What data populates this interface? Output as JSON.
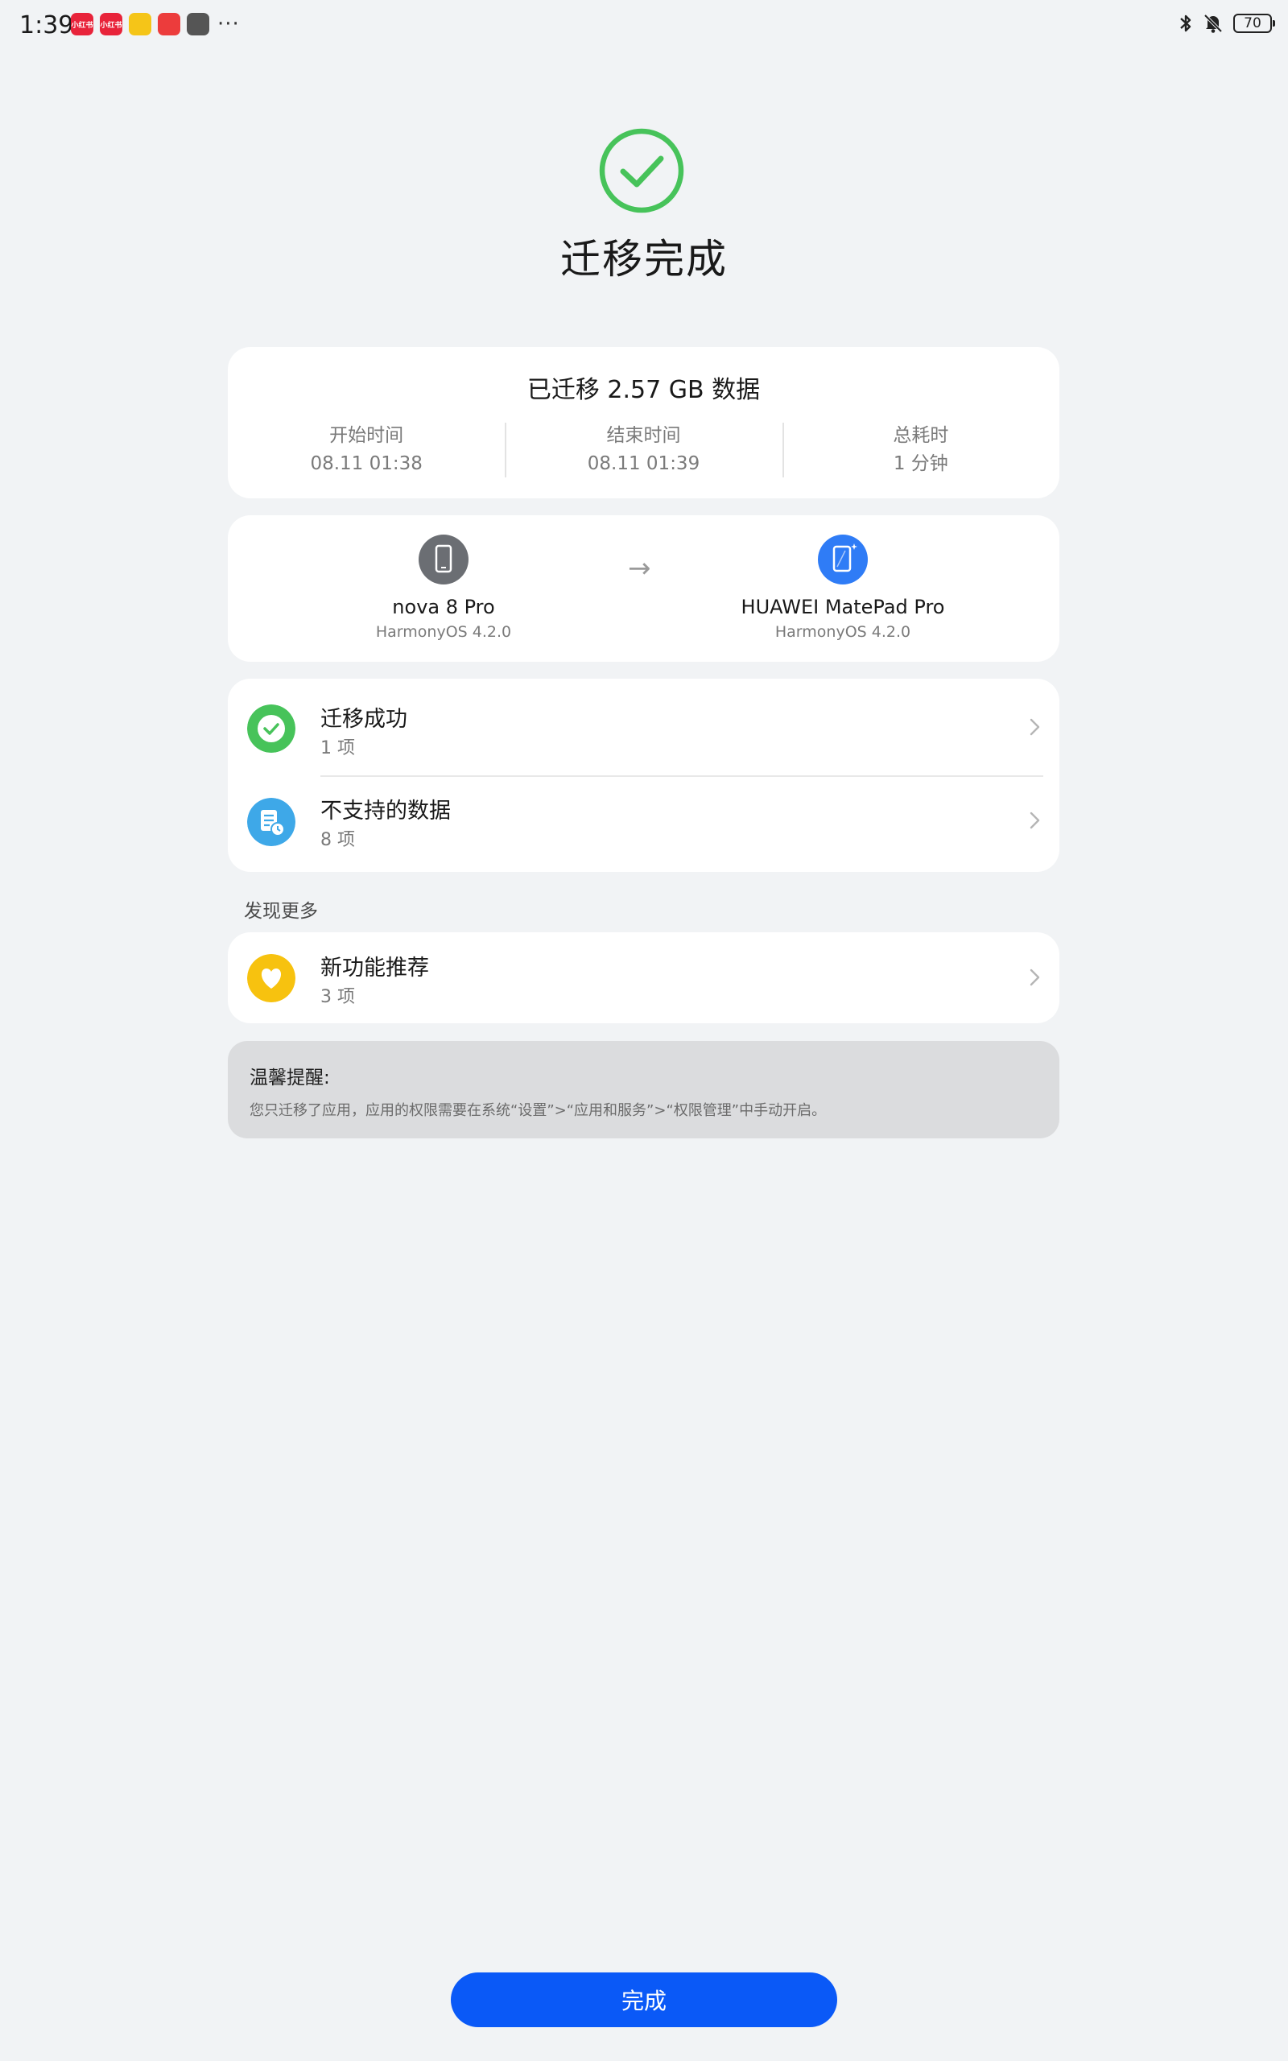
{
  "status_bar": {
    "time": "1:39",
    "app_icons": [
      {
        "name": "app-icon-1",
        "color": "#e8233a",
        "label": "小红书"
      },
      {
        "name": "app-icon-2",
        "color": "#e8233a",
        "label": "小红书"
      },
      {
        "name": "app-icon-3",
        "color": "#f5c518",
        "label": ""
      },
      {
        "name": "app-icon-4",
        "color": "#ec3c3c",
        "label": ""
      },
      {
        "name": "app-icon-5",
        "color": "#555555",
        "label": ""
      }
    ],
    "more": "···",
    "battery": "70"
  },
  "header": {
    "title": "迁移完成"
  },
  "summary": {
    "title": "已迁移 2.57 GB 数据",
    "stats": [
      {
        "label": "开始时间",
        "value": "08.11 01:38"
      },
      {
        "label": "结束时间",
        "value": "08.11 01:39"
      },
      {
        "label": "总耗时",
        "value": "1 分钟"
      }
    ]
  },
  "devices": {
    "source": {
      "name": "nova 8 Pro",
      "os": "HarmonyOS 4.2.0"
    },
    "arrow": "→",
    "target": {
      "name": "HUAWEI MatePad Pro",
      "os": "HarmonyOS 4.2.0"
    }
  },
  "results": [
    {
      "title": "迁移成功",
      "count": "1 项"
    },
    {
      "title": "不支持的数据",
      "count": "8 项"
    }
  ],
  "discover": {
    "label": "发现更多",
    "item": {
      "title": "新功能推荐",
      "count": "3 项"
    }
  },
  "notice": {
    "title": "温馨提醒:",
    "text": "您只迁移了应用，应用的权限需要在系统“设置”>“应用和服务”>“权限管理”中手动开启。"
  },
  "done_button": "完成",
  "colors": {
    "accent": "#0a59f7",
    "success": "#47c35a",
    "info": "#3ea8e8",
    "feature": "#f7c20f",
    "background": "#f1f3f5"
  }
}
